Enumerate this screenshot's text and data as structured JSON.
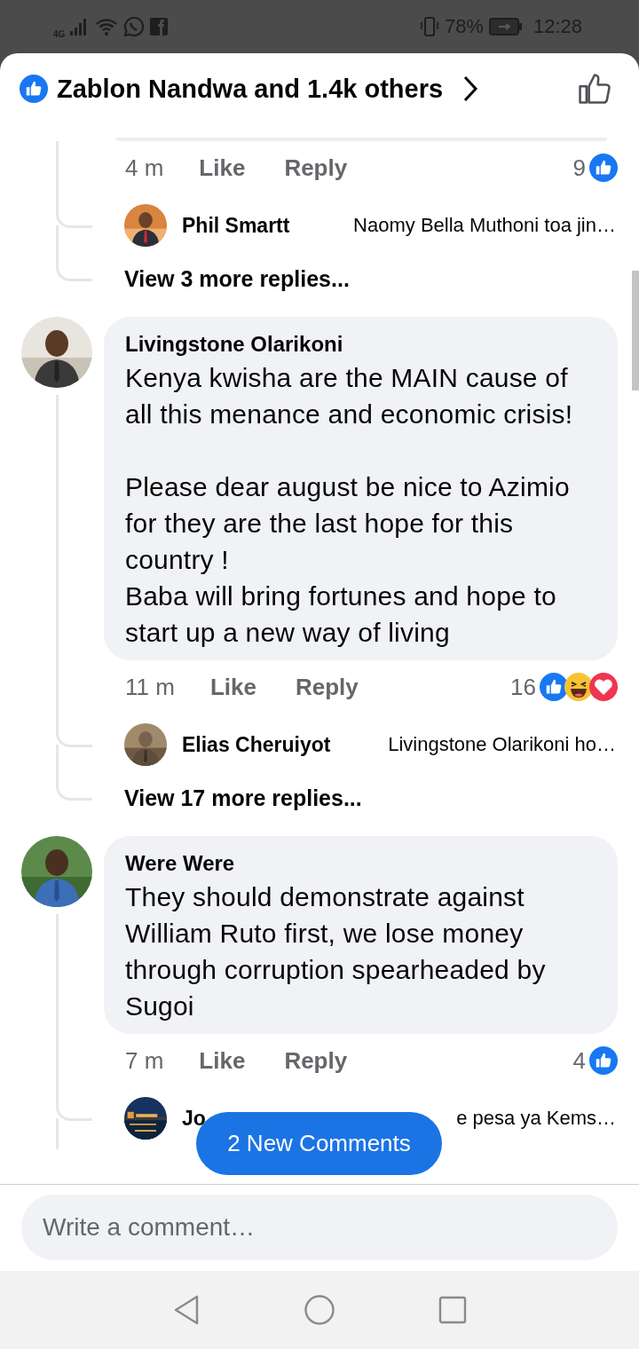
{
  "status_bar": {
    "network": "4G",
    "battery": "78%",
    "time": "12:28"
  },
  "header": {
    "title": "Zablon Nandwa and 1.4k others"
  },
  "comments": [
    {
      "kind": "cut",
      "time": "4 m",
      "like": "Like",
      "reply": "Reply",
      "reaction_count": "9",
      "reactions": [
        {
          "kind": "like"
        }
      ],
      "replies": [
        {
          "name": "Phil Smartt",
          "text": "Naomy Bella Muthoni toa jin…"
        }
      ],
      "more_replies": "View 3 more replies..."
    },
    {
      "kind": "full",
      "name": "Livingstone Olarikoni",
      "text": "Kenya kwisha are the MAIN cause of all this menance and economic crisis!\n\nPlease dear august be nice to Azimio for they are the last hope for this country !\nBaba will bring fortunes and hope to start up a new way of living",
      "time": "11 m",
      "like": "Like",
      "reply": "Reply",
      "reaction_count": "16",
      "reactions": [
        {
          "kind": "like"
        },
        {
          "kind": "haha"
        },
        {
          "kind": "love"
        }
      ],
      "replies": [
        {
          "name": "Elias Cheruiyot",
          "text": "Livingstone Olarikoni ho…"
        }
      ],
      "more_replies": "View 17 more replies..."
    },
    {
      "kind": "full",
      "name": "Were Were",
      "text": "They should demonstrate against William Ruto first, we lose money through corruption spearheaded by Sugoi",
      "time": "7 m",
      "like": "Like",
      "reply": "Reply",
      "reaction_count": "4",
      "reactions": [
        {
          "kind": "like"
        }
      ],
      "replies": [
        {
          "name": "Jo",
          "text": "e pesa ya Kems…"
        }
      ]
    }
  ],
  "new_comments_button": "2 New Comments",
  "composer": {
    "placeholder": "Write a comment…"
  }
}
